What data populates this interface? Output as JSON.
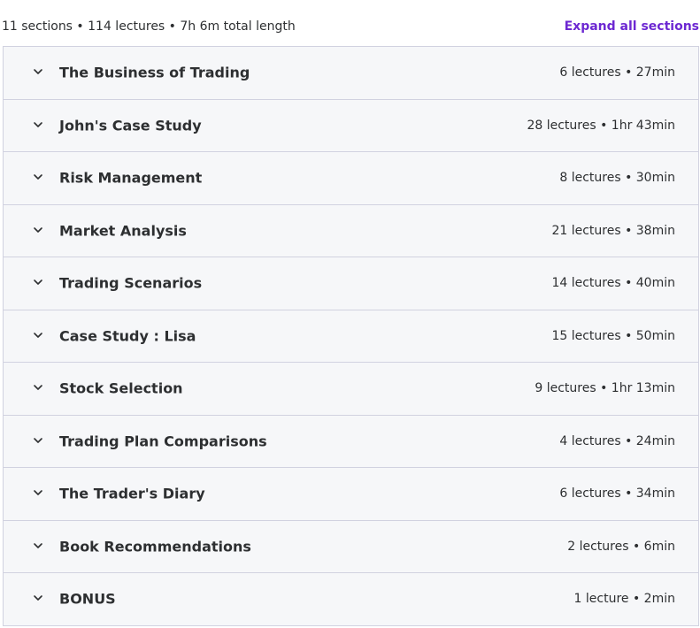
{
  "header": {
    "summary": "11 sections • 114 lectures • 7h 6m total length",
    "expand_label": "Expand all sections"
  },
  "colors": {
    "accent": "#6d28d2",
    "row_bg": "#f6f7f9",
    "border": "#d1d2e0",
    "text": "#2d2f31"
  },
  "sections": [
    {
      "title": "The Business of Trading",
      "meta": "6 lectures • 27min",
      "icon": "chevron-down-icon"
    },
    {
      "title": "John's Case Study",
      "meta": "28 lectures • 1hr 43min",
      "icon": "chevron-down-icon"
    },
    {
      "title": "Risk Management",
      "meta": "8 lectures • 30min",
      "icon": "chevron-down-icon"
    },
    {
      "title": "Market Analysis",
      "meta": "21 lectures • 38min",
      "icon": "chevron-down-icon"
    },
    {
      "title": "Trading Scenarios",
      "meta": "14 lectures • 40min",
      "icon": "chevron-down-icon"
    },
    {
      "title": "Case Study : Lisa",
      "meta": "15 lectures • 50min",
      "icon": "chevron-down-icon"
    },
    {
      "title": "Stock Selection",
      "meta": "9 lectures • 1hr 13min",
      "icon": "chevron-down-icon"
    },
    {
      "title": "Trading Plan Comparisons",
      "meta": "4 lectures • 24min",
      "icon": "chevron-down-icon"
    },
    {
      "title": "The Trader's Diary",
      "meta": "6 lectures • 34min",
      "icon": "chevron-down-icon"
    },
    {
      "title": "Book Recommendations",
      "meta": "2 lectures • 6min",
      "icon": "chevron-down-icon"
    },
    {
      "title": "BONUS",
      "meta": "1 lecture • 2min",
      "icon": "chevron-down-icon"
    }
  ]
}
